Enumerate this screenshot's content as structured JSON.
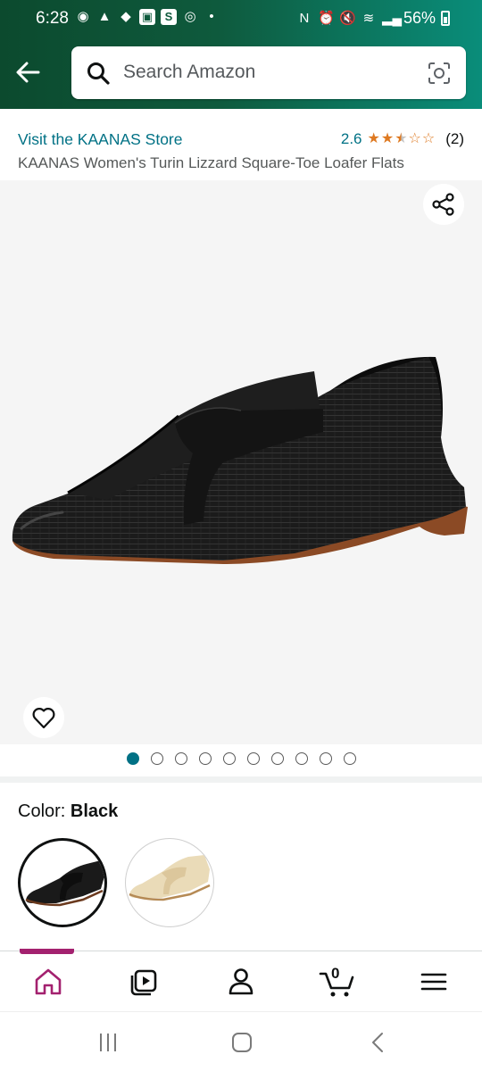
{
  "status_bar": {
    "time": "6:28",
    "battery": "56%"
  },
  "search": {
    "placeholder": "Search Amazon"
  },
  "product": {
    "store_link": "Visit the KAANAS Store",
    "rating_value": "2.6",
    "rating_stars": 2.6,
    "rating_count": "(2)",
    "title": "KAANAS Women's Turin Lizzard Square-Toe Loafer Flats"
  },
  "gallery": {
    "image_count": 10,
    "active_index": 0
  },
  "color": {
    "label": "Color: ",
    "selected": "Black",
    "options": [
      "black",
      "beige"
    ]
  },
  "nav": {
    "items": [
      "home-icon",
      "video-icon",
      "account-icon",
      "cart-icon",
      "menu-icon"
    ],
    "cart_count": "0",
    "accent": "#a3216f"
  },
  "colors": {
    "link": "#007185",
    "star": "#de7921",
    "header_start": "#0c4a2e",
    "header_end": "#0a8d7a"
  }
}
